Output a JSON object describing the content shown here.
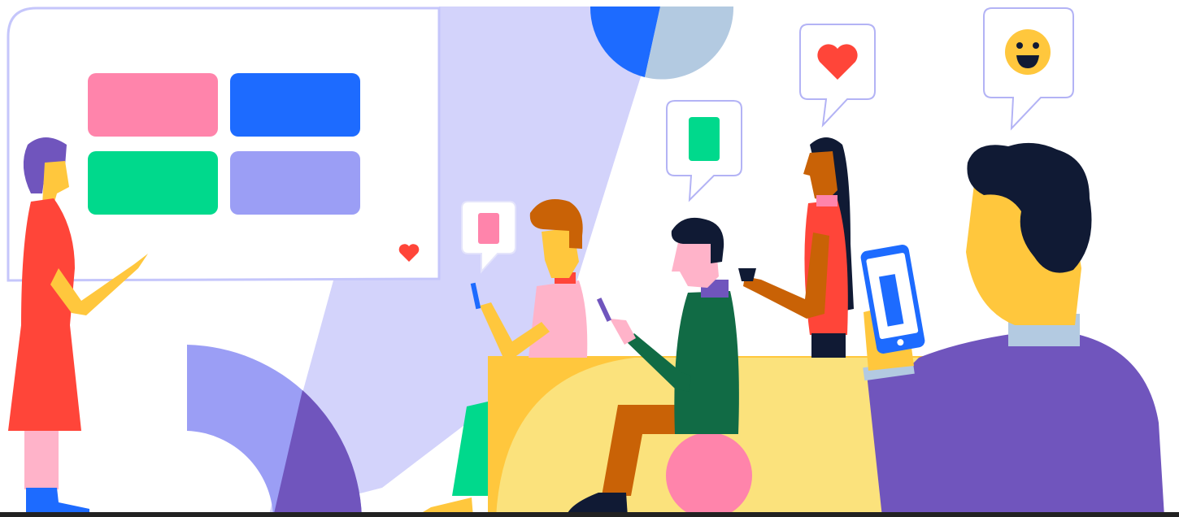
{
  "illustration": {
    "subject": "team-feedback-illustration",
    "people_count": 5,
    "colors": {
      "background": "#ffffff",
      "light_beam": "#d3d3fb",
      "accent_blue": "#1d6bff",
      "light_blue_circle": "#b3cae1",
      "pink": "#ff84ab",
      "green": "#00d98c",
      "periwinkle": "#9b9ef5",
      "purple": "#7055bd",
      "yellow_table": "#fbe27c",
      "yellow_skin": "#ffc73d",
      "red": "#ff4539",
      "dark_navy": "#101a34",
      "dark_green": "#116b45",
      "orange_brown": "#c96206",
      "bubble_border": "#b3b3f5",
      "bottom_bar": "#222222"
    },
    "whiteboard_cards": [
      "pink-card",
      "blue-card",
      "green-card",
      "periwinkle-card"
    ],
    "reactions": [
      "heart-icon",
      "smiley-icon",
      "pink-card-icon",
      "green-card-icon"
    ]
  }
}
